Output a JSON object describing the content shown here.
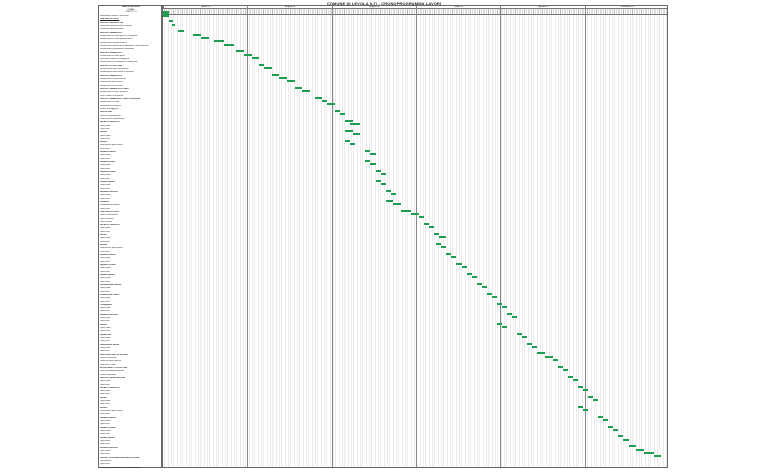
{
  "page_title": "COMUNE DI LEVOLA (LT) - CRONOPROGRAMMA LAVORI",
  "task_header": [
    "FASI DI ATTIVITA",
    "ORARI",
    "CAPPOTTI"
  ],
  "months": [
    "aprile-25",
    "maggio-25",
    "giugno-25",
    "luglio-25",
    "agosto-25",
    "settembre-25"
  ],
  "rows": [
    {
      "label": "Installazione cantiere e area lavori",
      "type": "task"
    },
    {
      "label": "CANTIERE LEVOLA 1",
      "type": "sec"
    },
    {
      "label": "LAVORI DI DEMOLIZIONE",
      "type": "sub"
    },
    {
      "label": "Demolizione pavimentazione esistente",
      "type": "task"
    },
    {
      "label": "Rimozione impianti esistenti",
      "type": "task"
    },
    {
      "label": "LAVORI DI FABBRICATO",
      "type": "sub"
    },
    {
      "label": "Realizzazione di nuove pareti in cartongesso",
      "type": "task"
    },
    {
      "label": "Realizzazione di nuovi impianti elettrici",
      "type": "task"
    },
    {
      "label": "Realizzazione di impianto idrico",
      "type": "task"
    },
    {
      "label": "Realizzazione impianto di riscaldamento e raffrescamento",
      "type": "task"
    },
    {
      "label": "Realizzazione di pavimenti e rivestimenti",
      "type": "task"
    },
    {
      "label": "LAVORI DI FABBRICATO",
      "type": "sub"
    },
    {
      "label": "Realizzazione di nuove pareti",
      "type": "task"
    },
    {
      "label": "Rifacimento intonaci e tinteggiature",
      "type": "task"
    },
    {
      "label": "Realizzazione di controsoffitti e coibentazioni",
      "type": "task"
    },
    {
      "label": "LAVORI DI COPERTURA",
      "type": "sub"
    },
    {
      "label": "Rimozione del manto di copertura",
      "type": "task"
    },
    {
      "label": "Realizzazione nuovo manto di copertura",
      "type": "task"
    },
    {
      "label": "LAVORI DI FABBRICATO",
      "type": "sub"
    },
    {
      "label": "Realizzazione di opere esterne",
      "type": "task"
    },
    {
      "label": "Sistemazione aree esterne",
      "type": "task"
    },
    {
      "label": "Realizzazione di recinzioni",
      "type": "task"
    },
    {
      "label": "LAVORI DI FABBRICATO PIANO",
      "type": "sub"
    },
    {
      "label": "Realizzazione di nuove partizioni",
      "type": "task"
    },
    {
      "label": "Posa in opera di serramenti",
      "type": "task"
    },
    {
      "label": "LAVORI DI FABBRICATO PIANO SUPERIORE",
      "type": "sub"
    },
    {
      "label": "Realizzazione di solaio",
      "type": "task"
    },
    {
      "label": "Realizzazione di impianti",
      "type": "task"
    },
    {
      "label": "Finiture e tinteggiature",
      "type": "task"
    },
    {
      "label": "LAVORI VARI",
      "type": "sub"
    },
    {
      "label": "Opere di completamento",
      "type": "task"
    },
    {
      "label": "Pulizia finale e smobilitazione",
      "type": "task"
    },
    {
      "label": "IMPIANTO IDRAULICO",
      "type": "sub"
    },
    {
      "label": "Opere prime",
      "type": "task"
    },
    {
      "label": "Opere finite",
      "type": "task"
    },
    {
      "label": "INFISSI",
      "type": "sub"
    },
    {
      "label": "Opere prime",
      "type": "task"
    },
    {
      "label": "Opere finite",
      "type": "task"
    },
    {
      "label": "Intonaci",
      "type": "sub"
    },
    {
      "label": "Sistemazione pareti interne",
      "type": "task"
    },
    {
      "label": "Opere finite",
      "type": "task"
    },
    {
      "label": "Impianto elettrico",
      "type": "sub"
    },
    {
      "label": "Opere prime",
      "type": "task"
    },
    {
      "label": "Opere finite",
      "type": "task"
    },
    {
      "label": "Impianto termico",
      "type": "sub"
    },
    {
      "label": "Opere prime",
      "type": "task"
    },
    {
      "label": "Opere finite",
      "type": "task"
    },
    {
      "label": "Impianto Termico",
      "type": "sub"
    },
    {
      "label": "Opere prime",
      "type": "task"
    },
    {
      "label": "Opere finite",
      "type": "task"
    },
    {
      "label": "Impianti speciali",
      "type": "sub"
    },
    {
      "label": "Opere prime",
      "type": "task"
    },
    {
      "label": "Opere finite",
      "type": "task"
    },
    {
      "label": "Impianto ascensore",
      "type": "sub"
    },
    {
      "label": "Opere prime",
      "type": "task"
    },
    {
      "label": "Opere finite",
      "type": "task"
    },
    {
      "label": "Pavimenti",
      "type": "sub"
    },
    {
      "label": "Pavimentazione interna",
      "type": "task"
    },
    {
      "label": "Opere finite",
      "type": "task"
    },
    {
      "label": "CANTIERE LEVOLA 2",
      "type": "sec"
    },
    {
      "label": "Opere di demolizione",
      "type": "task"
    },
    {
      "label": "Opere strutturali",
      "type": "task"
    },
    {
      "label": "Opere murarie",
      "type": "task"
    },
    {
      "label": "IMPIANTO IDRAULICO",
      "type": "sub"
    },
    {
      "label": "Opere prime",
      "type": "task"
    },
    {
      "label": "Opere finite",
      "type": "task"
    },
    {
      "label": "INFISSI",
      "type": "sub"
    },
    {
      "label": "Opere prime",
      "type": "task"
    },
    {
      "label": "Opere finite",
      "type": "task"
    },
    {
      "label": "Intonaci",
      "type": "sub"
    },
    {
      "label": "Sistemazione pareti interne",
      "type": "task"
    },
    {
      "label": "Opere finite",
      "type": "task"
    },
    {
      "label": "Impianto elettrico",
      "type": "sub"
    },
    {
      "label": "Opere prime",
      "type": "task"
    },
    {
      "label": "Opere finite",
      "type": "task"
    },
    {
      "label": "Impianto Termico",
      "type": "sub"
    },
    {
      "label": "Opere prime",
      "type": "task"
    },
    {
      "label": "Opere finite",
      "type": "task"
    },
    {
      "label": "Impianti speciali",
      "type": "sub"
    },
    {
      "label": "Opere prime",
      "type": "task"
    },
    {
      "label": "Opere finite",
      "type": "task"
    },
    {
      "label": "Pavimentazione interna",
      "type": "sub"
    },
    {
      "label": "Opere prime",
      "type": "task"
    },
    {
      "label": "Opere finite",
      "type": "task"
    },
    {
      "label": "Sistemazione esterna",
      "type": "sub"
    },
    {
      "label": "Opere prime",
      "type": "task"
    },
    {
      "label": "Opere finite",
      "type": "task"
    },
    {
      "label": "Tinteggiature",
      "type": "sub"
    },
    {
      "label": "Opere prime",
      "type": "task"
    },
    {
      "label": "Opere finite",
      "type": "task"
    },
    {
      "label": "Impianto ascensore",
      "type": "sub"
    },
    {
      "label": "Opere prime",
      "type": "task"
    },
    {
      "label": "Opere finite",
      "type": "task"
    },
    {
      "label": "INFISSI",
      "type": "sub"
    },
    {
      "label": "Opere prime",
      "type": "task"
    },
    {
      "label": "Opere finite",
      "type": "task"
    },
    {
      "label": "Impianti vari",
      "type": "sub"
    },
    {
      "label": "Opere prime",
      "type": "task"
    },
    {
      "label": "Opere finite",
      "type": "task"
    },
    {
      "label": "Realizzazione finiture",
      "type": "sub"
    },
    {
      "label": "Opere prime",
      "type": "task"
    },
    {
      "label": "Opere finite",
      "type": "task"
    },
    {
      "label": "REALIZZAZIONE COPERTURA",
      "type": "sec"
    },
    {
      "label": "Opere di rimozione",
      "type": "task"
    },
    {
      "label": "Opere di nuova copertura",
      "type": "task"
    },
    {
      "label": "Lattonerie e canali",
      "type": "task"
    },
    {
      "label": "ALLESTIMENTO COPERTURA",
      "type": "sec"
    },
    {
      "label": "Opere impermeabilizzazione",
      "type": "task"
    },
    {
      "label": "Pannelli fotovoltaici",
      "type": "task"
    },
    {
      "label": "LAVORI DI REALIZZAZIONE",
      "type": "sub"
    },
    {
      "label": "Opere prime",
      "type": "task"
    },
    {
      "label": "Opere finite",
      "type": "task"
    },
    {
      "label": "IMPIANTO IDRAULICO",
      "type": "sub"
    },
    {
      "label": "Opere prime",
      "type": "task"
    },
    {
      "label": "Opere finite",
      "type": "task"
    },
    {
      "label": "INFISSI",
      "type": "sub"
    },
    {
      "label": "Opere prime",
      "type": "task"
    },
    {
      "label": "Opere finite",
      "type": "task"
    },
    {
      "label": "Intonaci",
      "type": "sub"
    },
    {
      "label": "Sistemazione pareti interne",
      "type": "task"
    },
    {
      "label": "Opere finite",
      "type": "task"
    },
    {
      "label": "Impianto elettrico",
      "type": "sub"
    },
    {
      "label": "Opere prime",
      "type": "task"
    },
    {
      "label": "Opere finite",
      "type": "task"
    },
    {
      "label": "Impianto Termico",
      "type": "sub"
    },
    {
      "label": "Opere prime",
      "type": "task"
    },
    {
      "label": "Opere finite",
      "type": "task"
    },
    {
      "label": "Impianti speciali",
      "type": "sub"
    },
    {
      "label": "Opere prime",
      "type": "task"
    },
    {
      "label": "Opere finite",
      "type": "task"
    },
    {
      "label": "Impianto ascensore",
      "type": "sub"
    },
    {
      "label": "Opere prime",
      "type": "task"
    },
    {
      "label": "Opere finite",
      "type": "task"
    },
    {
      "label": "LAVORI DI SISTEMAZIONE AREE ESTERNE",
      "type": "sec"
    },
    {
      "label": "Sistemazione",
      "type": "task"
    },
    {
      "label": "Opere finite",
      "type": "task"
    },
    {
      "label": "COLLAUDI, VERIFICHE E CHIUSURA LAVORI",
      "type": "sec"
    }
  ],
  "bars": [
    {
      "row": 0,
      "start": 0.0,
      "end": 0.012
    },
    {
      "row": 3,
      "start": 0.012,
      "end": 0.02
    },
    {
      "row": 4,
      "start": 0.018,
      "end": 0.024
    },
    {
      "row": 6,
      "start": 0.03,
      "end": 0.042
    },
    {
      "row": 7,
      "start": 0.06,
      "end": 0.075
    },
    {
      "row": 8,
      "start": 0.075,
      "end": 0.09
    },
    {
      "row": 9,
      "start": 0.1,
      "end": 0.12
    },
    {
      "row": 10,
      "start": 0.12,
      "end": 0.14
    },
    {
      "row": 12,
      "start": 0.145,
      "end": 0.16
    },
    {
      "row": 13,
      "start": 0.16,
      "end": 0.175
    },
    {
      "row": 14,
      "start": 0.175,
      "end": 0.19
    },
    {
      "row": 16,
      "start": 0.19,
      "end": 0.2
    },
    {
      "row": 17,
      "start": 0.2,
      "end": 0.215
    },
    {
      "row": 19,
      "start": 0.215,
      "end": 0.23
    },
    {
      "row": 20,
      "start": 0.23,
      "end": 0.245
    },
    {
      "row": 21,
      "start": 0.245,
      "end": 0.26
    },
    {
      "row": 23,
      "start": 0.26,
      "end": 0.275
    },
    {
      "row": 24,
      "start": 0.275,
      "end": 0.29
    },
    {
      "row": 26,
      "start": 0.3,
      "end": 0.315
    },
    {
      "row": 27,
      "start": 0.315,
      "end": 0.325
    },
    {
      "row": 28,
      "start": 0.325,
      "end": 0.34
    },
    {
      "row": 30,
      "start": 0.34,
      "end": 0.35
    },
    {
      "row": 31,
      "start": 0.35,
      "end": 0.36
    },
    {
      "row": 33,
      "start": 0.36,
      "end": 0.375
    },
    {
      "row": 34,
      "start": 0.37,
      "end": 0.39
    },
    {
      "row": 36,
      "start": 0.36,
      "end": 0.375
    },
    {
      "row": 37,
      "start": 0.375,
      "end": 0.39
    },
    {
      "row": 39,
      "start": 0.36,
      "end": 0.37
    },
    {
      "row": 40,
      "start": 0.37,
      "end": 0.38
    },
    {
      "row": 42,
      "start": 0.4,
      "end": 0.41
    },
    {
      "row": 43,
      "start": 0.41,
      "end": 0.42
    },
    {
      "row": 45,
      "start": 0.4,
      "end": 0.41
    },
    {
      "row": 46,
      "start": 0.41,
      "end": 0.42
    },
    {
      "row": 48,
      "start": 0.42,
      "end": 0.43
    },
    {
      "row": 49,
      "start": 0.43,
      "end": 0.44
    },
    {
      "row": 51,
      "start": 0.42,
      "end": 0.43
    },
    {
      "row": 52,
      "start": 0.43,
      "end": 0.44
    },
    {
      "row": 54,
      "start": 0.44,
      "end": 0.45
    },
    {
      "row": 55,
      "start": 0.45,
      "end": 0.46
    },
    {
      "row": 57,
      "start": 0.44,
      "end": 0.455
    },
    {
      "row": 58,
      "start": 0.455,
      "end": 0.47
    },
    {
      "row": 60,
      "start": 0.47,
      "end": 0.49
    },
    {
      "row": 61,
      "start": 0.49,
      "end": 0.505
    },
    {
      "row": 62,
      "start": 0.505,
      "end": 0.515
    },
    {
      "row": 64,
      "start": 0.515,
      "end": 0.525
    },
    {
      "row": 65,
      "start": 0.525,
      "end": 0.535
    },
    {
      "row": 67,
      "start": 0.535,
      "end": 0.545
    },
    {
      "row": 68,
      "start": 0.545,
      "end": 0.56
    },
    {
      "row": 70,
      "start": 0.54,
      "end": 0.55
    },
    {
      "row": 71,
      "start": 0.55,
      "end": 0.56
    },
    {
      "row": 73,
      "start": 0.56,
      "end": 0.57
    },
    {
      "row": 74,
      "start": 0.57,
      "end": 0.58
    },
    {
      "row": 76,
      "start": 0.58,
      "end": 0.59
    },
    {
      "row": 77,
      "start": 0.59,
      "end": 0.6
    },
    {
      "row": 79,
      "start": 0.6,
      "end": 0.61
    },
    {
      "row": 80,
      "start": 0.61,
      "end": 0.62
    },
    {
      "row": 82,
      "start": 0.62,
      "end": 0.63
    },
    {
      "row": 83,
      "start": 0.63,
      "end": 0.64
    },
    {
      "row": 85,
      "start": 0.64,
      "end": 0.65
    },
    {
      "row": 86,
      "start": 0.65,
      "end": 0.66
    },
    {
      "row": 88,
      "start": 0.66,
      "end": 0.67
    },
    {
      "row": 89,
      "start": 0.67,
      "end": 0.68
    },
    {
      "row": 91,
      "start": 0.68,
      "end": 0.69
    },
    {
      "row": 92,
      "start": 0.69,
      "end": 0.7
    },
    {
      "row": 94,
      "start": 0.66,
      "end": 0.67
    },
    {
      "row": 95,
      "start": 0.67,
      "end": 0.68
    },
    {
      "row": 97,
      "start": 0.7,
      "end": 0.71
    },
    {
      "row": 98,
      "start": 0.71,
      "end": 0.72
    },
    {
      "row": 100,
      "start": 0.72,
      "end": 0.73
    },
    {
      "row": 101,
      "start": 0.73,
      "end": 0.74
    },
    {
      "row": 103,
      "start": 0.74,
      "end": 0.755
    },
    {
      "row": 104,
      "start": 0.755,
      "end": 0.77
    },
    {
      "row": 105,
      "start": 0.77,
      "end": 0.78
    },
    {
      "row": 107,
      "start": 0.78,
      "end": 0.79
    },
    {
      "row": 108,
      "start": 0.79,
      "end": 0.8
    },
    {
      "row": 110,
      "start": 0.8,
      "end": 0.81
    },
    {
      "row": 111,
      "start": 0.81,
      "end": 0.82
    },
    {
      "row": 113,
      "start": 0.82,
      "end": 0.83
    },
    {
      "row": 114,
      "start": 0.83,
      "end": 0.84
    },
    {
      "row": 116,
      "start": 0.84,
      "end": 0.85
    },
    {
      "row": 117,
      "start": 0.85,
      "end": 0.86
    },
    {
      "row": 119,
      "start": 0.82,
      "end": 0.83
    },
    {
      "row": 120,
      "start": 0.83,
      "end": 0.84
    },
    {
      "row": 122,
      "start": 0.86,
      "end": 0.87
    },
    {
      "row": 123,
      "start": 0.87,
      "end": 0.88
    },
    {
      "row": 125,
      "start": 0.88,
      "end": 0.89
    },
    {
      "row": 126,
      "start": 0.89,
      "end": 0.9
    },
    {
      "row": 128,
      "start": 0.9,
      "end": 0.91
    },
    {
      "row": 129,
      "start": 0.91,
      "end": 0.92
    },
    {
      "row": 131,
      "start": 0.92,
      "end": 0.935
    },
    {
      "row": 132,
      "start": 0.935,
      "end": 0.95
    },
    {
      "row": 133,
      "start": 0.95,
      "end": 0.97
    },
    {
      "row": 134,
      "start": 0.97,
      "end": 0.985
    }
  ]
}
